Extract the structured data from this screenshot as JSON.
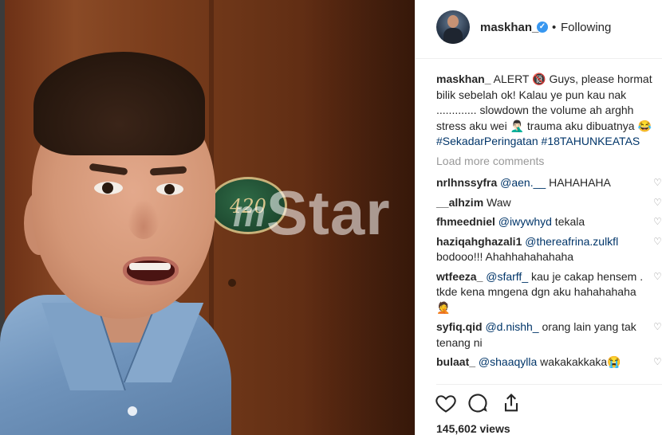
{
  "media": {
    "plaque_number": "420",
    "watermark": "Star",
    "watermark_prefix": "m"
  },
  "header": {
    "username": "maskhan_",
    "separator": "•",
    "follow_status": "Following"
  },
  "caption": {
    "username": "maskhan_",
    "text": "ALERT 🔞 Guys, please hormat bilik sebelah ok! Kalau ye pun kau nak ............. slowdown the volume ah arghh stress aku wei 🤦🏻‍♂️ trauma aku dibuatnya 😂 ",
    "hashtags": "#SekadarPeringatan #18TAHUNKEATAS"
  },
  "load_more": "Load more comments",
  "comments": [
    {
      "user": "nrlhnssyfra",
      "mention": "@aen.__",
      "text": " HAHAHAHA"
    },
    {
      "user": "__alhzim",
      "mention": "",
      "text": "Waw"
    },
    {
      "user": "fhmeedniel",
      "mention": "@iwywhyd",
      "text": " tekala"
    },
    {
      "user": "haziqahghazali1",
      "mention": "@thereafrina.zulkfl",
      "text": " bodooo!!! Ahahhahahahaha"
    },
    {
      "user": "wtfeeza_",
      "mention": "@sfarff_",
      "text": " kau je cakap hensem . tkde kena mngena dgn aku hahahahaha 🤦"
    },
    {
      "user": "syfiq.qid",
      "mention": "@d.nishh_",
      "text": " orang lain yang tak tenang ni"
    },
    {
      "user": "bulaat_",
      "mention": "@shaaqylla",
      "text": " wakakakkaka😭"
    }
  ],
  "actions": {
    "like_icon": "heart-icon",
    "comment_icon": "comment-bubble-icon",
    "share_icon": "share-icon"
  },
  "views": "145,602 views",
  "colors": {
    "link": "#003569",
    "verified": "#3897f0",
    "muted": "#999999"
  }
}
